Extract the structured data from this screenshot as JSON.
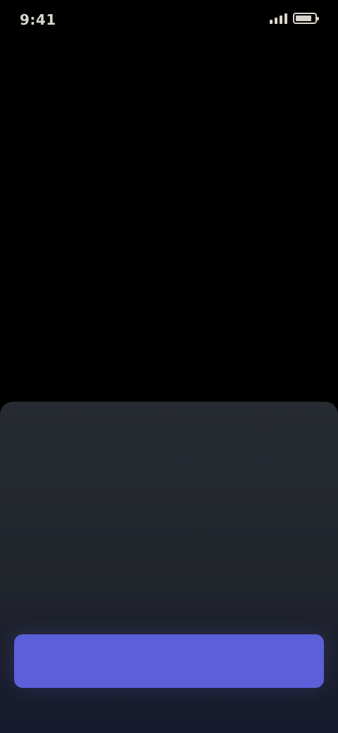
{
  "status_bar": {
    "time": "9:41",
    "signal_icon": "signal-icon",
    "battery_icon": "battery-icon",
    "battery_level": 0.85
  },
  "hero": {
    "title": "",
    "subtitle": ""
  },
  "sheet": {
    "header": "",
    "options": [
      {
        "caption": "",
        "value": ""
      },
      {
        "caption": "",
        "value": ""
      },
      {
        "caption": "",
        "value": ""
      }
    ]
  },
  "primary_button": {
    "label": ""
  },
  "colors": {
    "background": "#000000",
    "sheet": "#23272e",
    "accent": "#5b5fd8"
  }
}
